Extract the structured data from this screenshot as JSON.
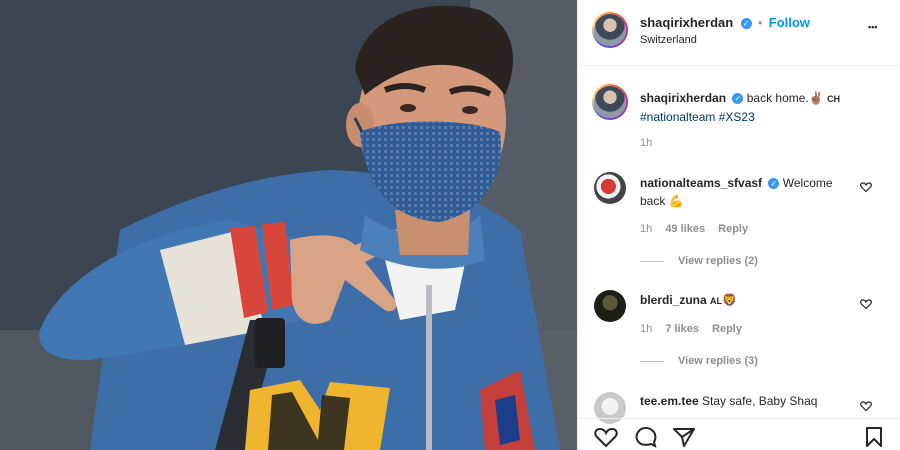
{
  "header": {
    "username": "shaqirixherdan",
    "follow_separator": "•",
    "follow_label": "Follow",
    "location": "Switzerland",
    "more_label": "•••"
  },
  "caption": {
    "username": "shaqirixherdan",
    "text": "back home.",
    "emoji": "✌🏽",
    "flag": "CH",
    "hashtags": "#nationalteam #XS23",
    "time": "1h"
  },
  "comments": [
    {
      "username": "nationalteams_sfvasf",
      "text_line1": "Welcome",
      "text_line2": "back",
      "emoji": "💪",
      "time": "1h",
      "likes": "49 likes",
      "reply_label": "Reply",
      "view_replies": "View replies (2)"
    },
    {
      "username": "blerdi_zuna",
      "flag": "AL",
      "emoji": "🦁",
      "time": "1h",
      "likes": "7 likes",
      "reply_label": "Reply",
      "view_replies": "View replies (3)"
    },
    {
      "username": "tee.em.tee",
      "text": "Stay safe, Baby Shaq"
    }
  ],
  "colors": {
    "accent": "#0095f6",
    "verified": "#3897f0",
    "text": "#262626",
    "muted": "#8e8e8e"
  }
}
